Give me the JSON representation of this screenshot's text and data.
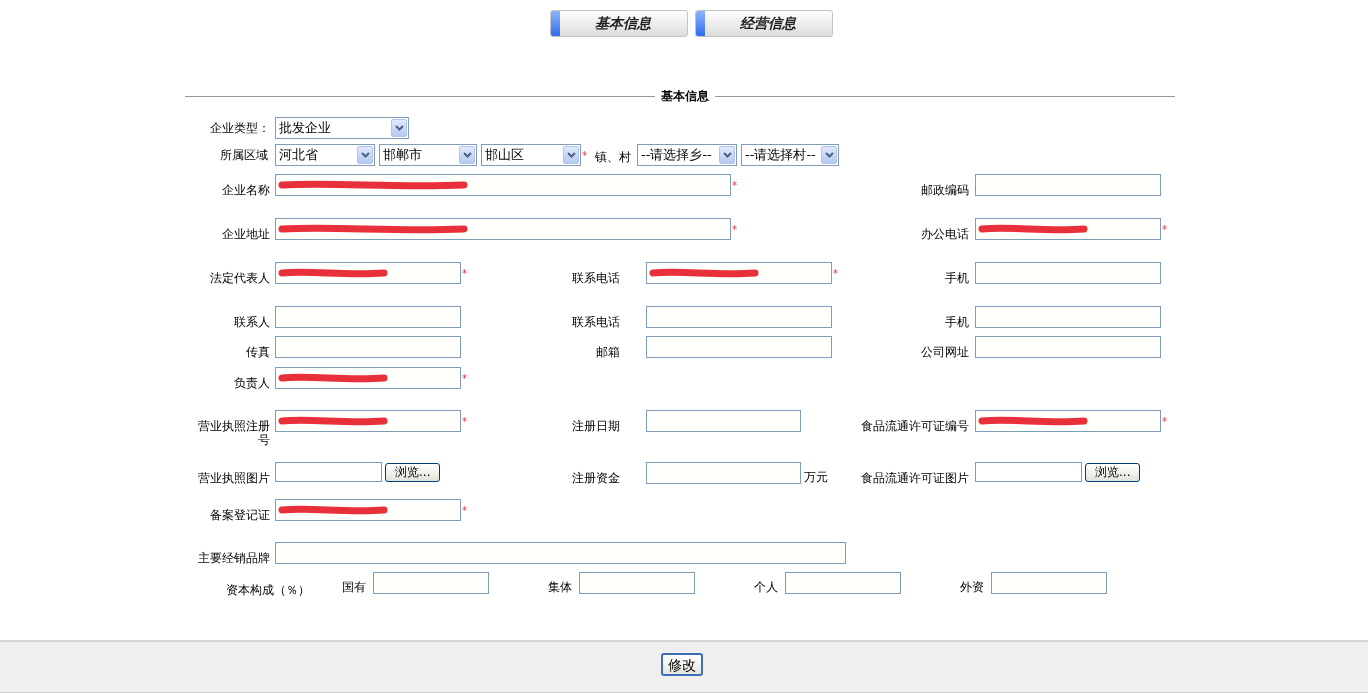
{
  "tabs": [
    {
      "label": "基本信息"
    },
    {
      "label": "经营信息"
    }
  ],
  "section_title": "基本信息",
  "enterprise_type": {
    "label": "企业类型：",
    "value": "批发企业"
  },
  "region": {
    "label": "所属区域",
    "selects": [
      "河北省",
      "邯郸市",
      "邯山区"
    ],
    "marker": "*",
    "town_label": "镇、村",
    "town_selects": [
      "--请选择乡--",
      "--请选择村--"
    ]
  },
  "rows": [
    {
      "left": {
        "label": "企业名称",
        "kind": "wide",
        "redacted": true,
        "marker": "*"
      },
      "right": {
        "label": "邮政编码",
        "kind": "text",
        "redacted": false
      }
    },
    {
      "left": {
        "label": "企业地址",
        "kind": "wide",
        "redacted": true,
        "marker": "*"
      },
      "right": {
        "label": "办公电话",
        "kind": "text",
        "redacted": true,
        "marker": "*"
      }
    },
    {
      "left": {
        "label": "法定代表人",
        "kind": "text",
        "redacted": true,
        "marker": "*"
      },
      "middle": {
        "label": "联系电话",
        "kind": "text",
        "redacted": true,
        "marker": "*"
      },
      "right": {
        "label": "手机",
        "kind": "text",
        "redacted": false
      }
    },
    {
      "left": {
        "label": "联系人",
        "kind": "text",
        "redacted": false
      },
      "middle": {
        "label": "联系电话",
        "kind": "text",
        "redacted": false
      },
      "right": {
        "label": "手机",
        "kind": "text",
        "redacted": false
      }
    },
    {
      "left": {
        "label": "传真",
        "kind": "text",
        "redacted": false
      },
      "middle": {
        "label": "邮箱",
        "kind": "text",
        "redacted": false
      },
      "right": {
        "label": "公司网址",
        "kind": "text",
        "redacted": false
      }
    },
    {
      "left": {
        "label": "负责人",
        "kind": "text",
        "redacted": true,
        "marker": "*"
      }
    },
    {
      "left": {
        "label": "营业执照注册号",
        "kind": "text",
        "redacted": true,
        "marker": "*"
      },
      "middle": {
        "label": "注册日期",
        "kind": "short",
        "redacted": false
      },
      "right": {
        "label": "食品流通许可证编号",
        "kind": "text",
        "redacted": true,
        "marker": "*"
      }
    },
    {
      "left": {
        "label": "营业执照图片",
        "kind": "file",
        "button": "浏览..."
      },
      "middle": {
        "label": "注册资金",
        "kind": "short",
        "redacted": false,
        "unit": "万元"
      },
      "right": {
        "label": "食品流通许可证图片",
        "kind": "file",
        "button": "浏览..."
      }
    },
    {
      "left": {
        "label": "备案登记证",
        "kind": "text",
        "redacted": true,
        "marker": "*"
      }
    },
    {
      "left": {
        "label": "主要经销品牌",
        "kind": "brand",
        "redacted": false
      }
    }
  ],
  "capital": {
    "label": "资本构成（％）",
    "parts": [
      {
        "label": "国有"
      },
      {
        "label": "集体"
      },
      {
        "label": "个人"
      },
      {
        "label": "外资"
      }
    ]
  },
  "submit_button": "修改"
}
